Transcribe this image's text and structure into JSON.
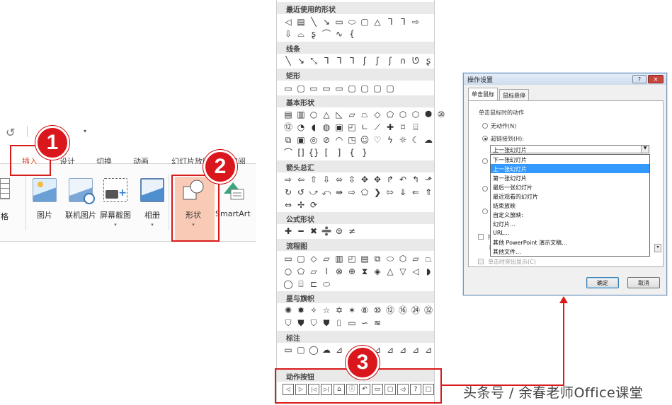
{
  "ribbon": {
    "qat_icon": "undo-icon",
    "tabs": [
      {
        "label": "插入",
        "active": true
      },
      {
        "label": "设计"
      },
      {
        "label": "切换"
      },
      {
        "label": "动画"
      },
      {
        "label": "幻灯片放映"
      },
      {
        "label": "审阅"
      }
    ],
    "left_cut_label": "格",
    "buttons": [
      {
        "label": "图片"
      },
      {
        "label": "联机图片"
      },
      {
        "label": "屏幕截图"
      },
      {
        "label": "相册"
      },
      {
        "label": "形状"
      },
      {
        "label": "SmartArt"
      }
    ]
  },
  "steps": [
    "1",
    "2",
    "3"
  ],
  "shapes_panel": {
    "sections": [
      {
        "title": "最近使用的形状"
      },
      {
        "title": "线条"
      },
      {
        "title": "矩形"
      },
      {
        "title": "基本形状"
      },
      {
        "title": "箭头总汇"
      },
      {
        "title": "公式形状"
      },
      {
        "title": "流程图"
      },
      {
        "title": "星与旗帜"
      },
      {
        "title": "标注"
      },
      {
        "title": "动作按钮"
      }
    ],
    "action_buttons_glyphs": [
      "◁",
      "▷",
      "|◁",
      "▷|",
      "⌂",
      "ⓘ",
      "↶",
      "▭",
      "▢",
      "◁)",
      "?",
      "□"
    ]
  },
  "dialog": {
    "title": "操作设置",
    "help_label": "?",
    "close_label": "✕",
    "tabs": [
      {
        "label": "单击鼠标",
        "active": true
      },
      {
        "label": "鼠标悬停"
      }
    ],
    "group_label": "单击鼠标时的动作",
    "option_none": "无动作(N)",
    "option_link": "超链接到(H):",
    "combo_value": "上一张幻灯片",
    "dropdown_items": [
      {
        "label": "下一张幻灯片"
      },
      {
        "label": "上一张幻灯片",
        "selected": true
      },
      {
        "label": "第一张幻灯片"
      },
      {
        "label": "最后一张幻灯片"
      },
      {
        "label": "最近观看的幻灯片"
      },
      {
        "label": "结束放映"
      },
      {
        "label": "自定义放映:"
      },
      {
        "label": "幻灯片..."
      },
      {
        "label": "URL..."
      },
      {
        "label": "其他 PowerPoint 演示文稿..."
      },
      {
        "label": "其他文件..."
      }
    ],
    "partial_play": "播",
    "partial_combo": "[",
    "highlight_label": "单击时突出显示(C)",
    "ok_label": "确定",
    "cancel_label": "取消"
  },
  "watermark": "头条号 / 余春老师Office课堂",
  "colors": {
    "accent_red": "#d91a1a",
    "ribbon_tab_active": "#d24726",
    "dropdown_select": "#3399ff"
  }
}
